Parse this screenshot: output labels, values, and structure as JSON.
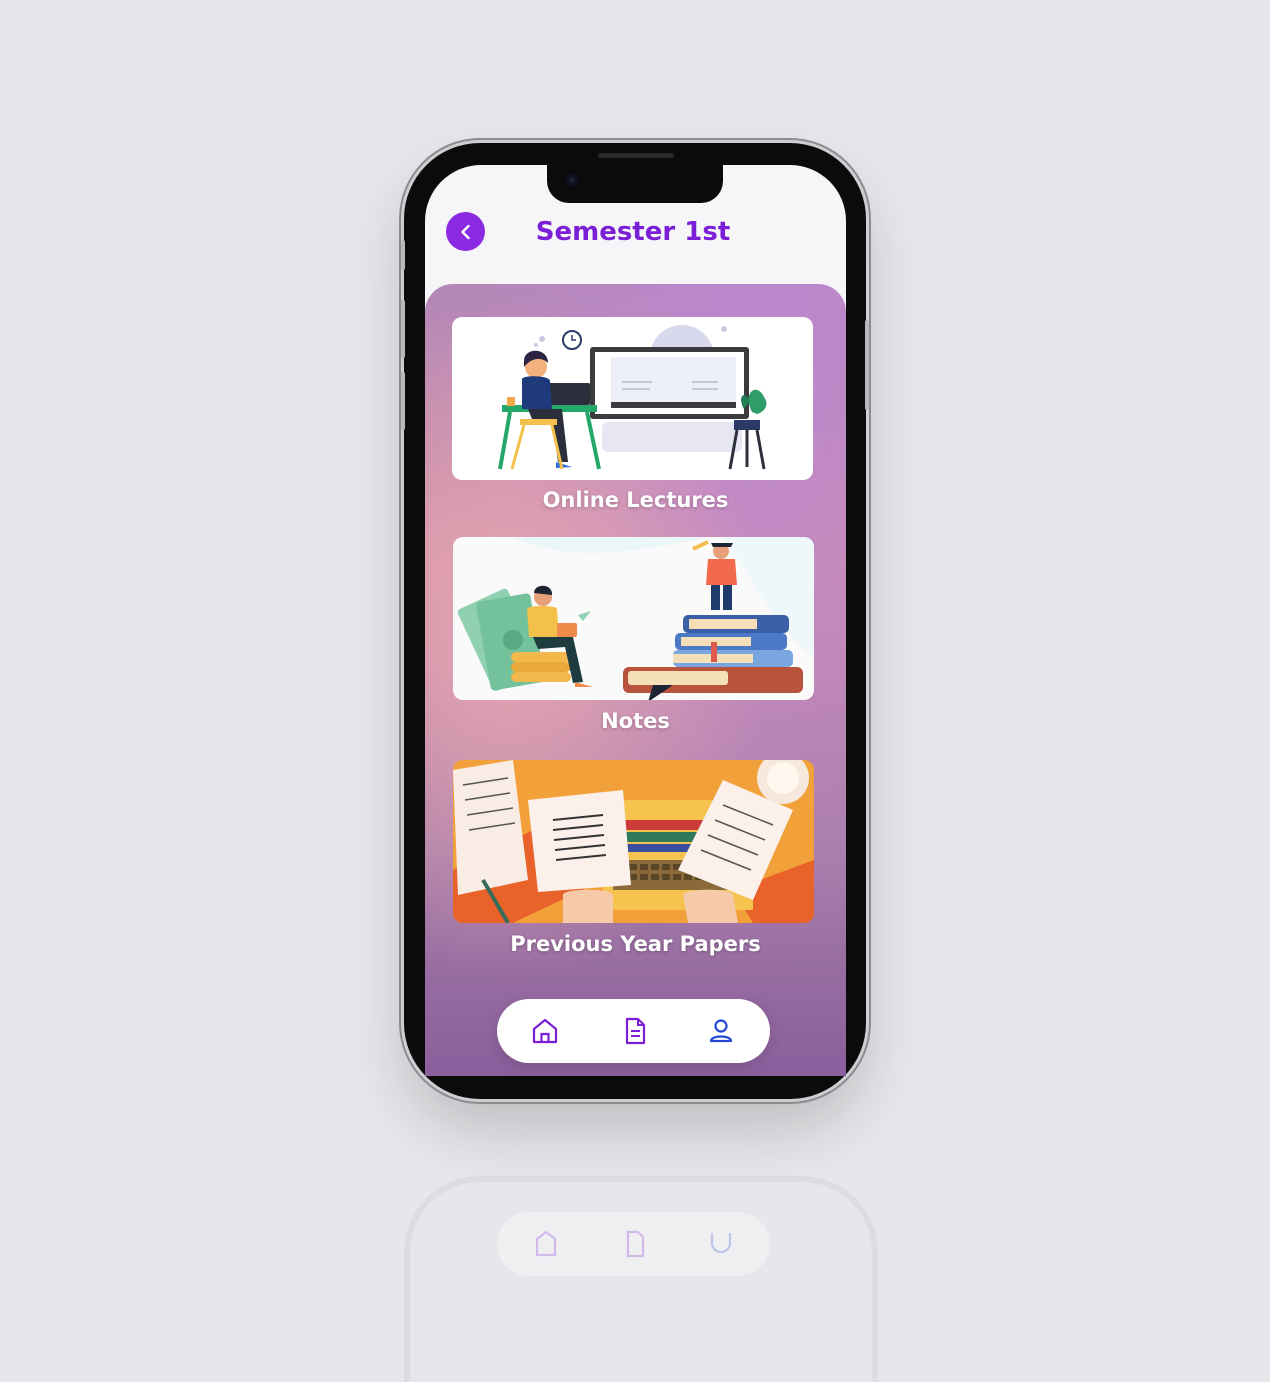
{
  "header": {
    "title": "Semester 1st"
  },
  "cards": [
    {
      "label": "Online Lectures"
    },
    {
      "label": "Notes"
    },
    {
      "label": "Previous Year Papers"
    }
  ],
  "nav": {
    "items": [
      "home-icon",
      "document-icon",
      "profile-icon"
    ]
  },
  "colors": {
    "accent": "#7a1fd6",
    "back_button": "#8a2be2",
    "nav_profile": "#2447d8"
  }
}
